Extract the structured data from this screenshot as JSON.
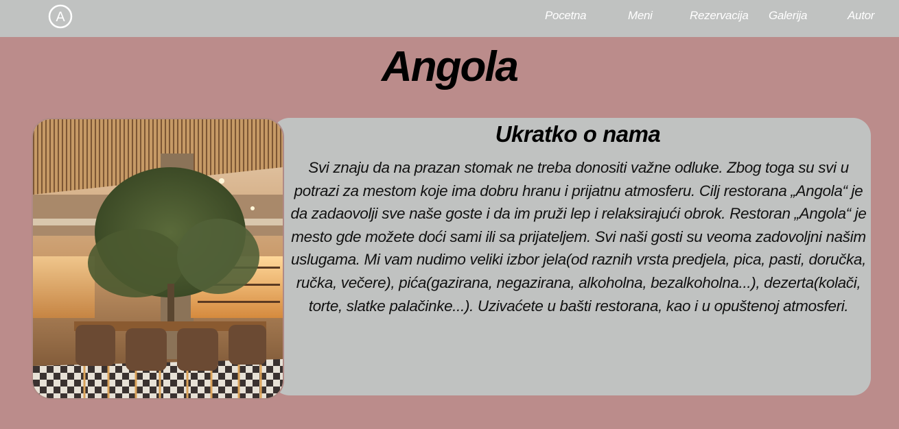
{
  "nav": {
    "logo_letter": "A",
    "links": [
      {
        "label": "Pocetna"
      },
      {
        "label": "Meni"
      },
      {
        "label": "Rezervacija"
      },
      {
        "label": "Galerija"
      },
      {
        "label": "Autor"
      }
    ]
  },
  "page": {
    "title": "Angola"
  },
  "about": {
    "heading": "Ukratko o nama",
    "text": "Svi znaju da na prazan stomak ne treba donositi važne odluke. Zbog toga su svi u potrazi za mestom koje ima dobru hranu i prijatnu atmosferu. Cilj restorana „Angola“ je da zadaovolji sve naše goste i da im pruži lep i relaksirajući obrok. Restoran „Angola“ je mesto gde možete doći sami ili sa prijateljem. Svi naši gosti su veoma zadovoljni našim uslugama. Mi vam nudimo veliki izbor jela(od raznih vrsta predjela, pica, pasti, doručka, ručka, večere), pića(gazirana, negazirana, alkoholna, bezalkoholna...), dezerta(kolači, torte, slatke palačinke...). Uzivaćete u bašti restorana, kao i u opuštenoj atmosferi."
  },
  "colors": {
    "background": "#bb8c8b",
    "navbar": "#c0c2c1",
    "card": "#c0c2c1",
    "nav_text": "#ffffff"
  },
  "icons": {
    "logo": "circle-a-logo-icon"
  }
}
